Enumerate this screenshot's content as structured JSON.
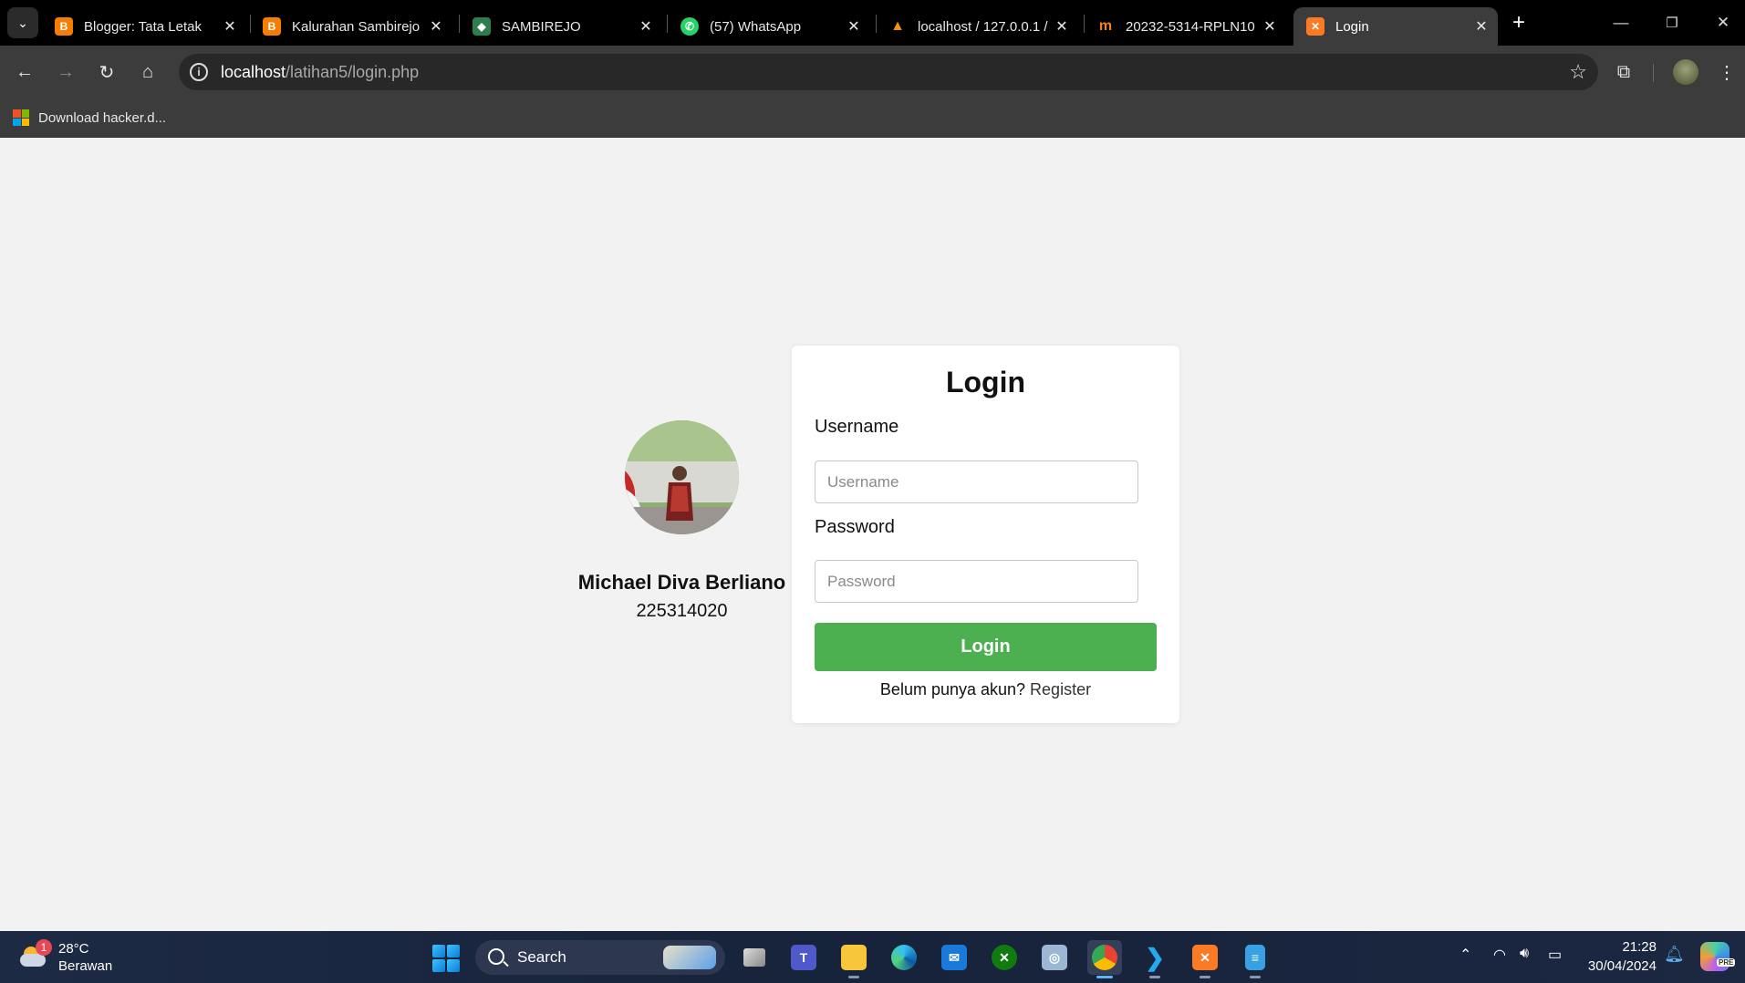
{
  "browser": {
    "tabs": [
      {
        "title": "Blogger: Tata Letak",
        "favicon": "blogger-icon",
        "color": "#f57d00"
      },
      {
        "title": "Kalurahan Sambirejo",
        "favicon": "blogger-icon",
        "color": "#f57d00"
      },
      {
        "title": "SAMBIREJO",
        "favicon": "crest-icon",
        "color": "#2f7d4a"
      },
      {
        "title": "(57) WhatsApp",
        "favicon": "whatsapp-icon",
        "color": "#25d366"
      },
      {
        "title": "localhost / 127.0.0.1 /",
        "favicon": "phpmyadmin-icon",
        "color": "#f29111"
      },
      {
        "title": "20232-5314-RPLN10",
        "favicon": "moodle-icon",
        "color": "#f98012"
      },
      {
        "title": "Login",
        "favicon": "xampp-icon",
        "color": "#fb7a24",
        "active": true
      }
    ],
    "url": {
      "host": "localhost",
      "path": "/latihan5/login.php"
    },
    "bookmarks": [
      {
        "label": "Download hacker.d..."
      }
    ]
  },
  "profile": {
    "name": "Michael Diva Berliano",
    "student_id": "225314020"
  },
  "login_form": {
    "title": "Login",
    "username_label": "Username",
    "username_placeholder": "Username",
    "username_value": "",
    "password_label": "Password",
    "password_placeholder": "Password",
    "password_value": "",
    "submit_label": "Login",
    "register_prompt": "Belum punya akun?",
    "register_link": "Register",
    "button_color": "#4caf50"
  },
  "taskbar": {
    "weather": {
      "temp": "28°C",
      "desc": "Berawan",
      "badge": "1"
    },
    "search_label": "Search",
    "apps": [
      "task-view",
      "teams",
      "file-explorer",
      "edge",
      "mail",
      "xbox",
      "remote-desktop",
      "chrome",
      "vscode",
      "xampp",
      "notepad"
    ],
    "clock": {
      "time": "21:28",
      "date": "30/04/2024"
    },
    "copilot_badge": "PRE"
  }
}
